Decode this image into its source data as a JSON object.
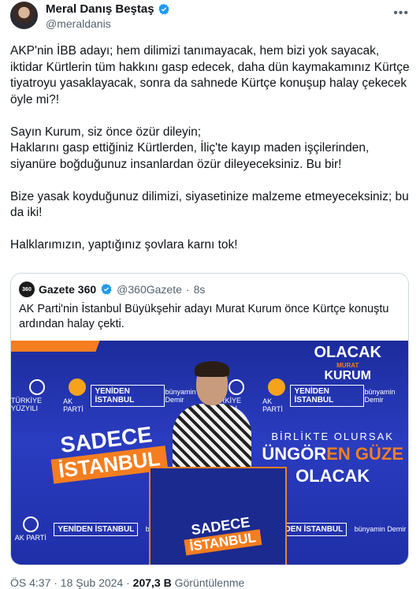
{
  "author": {
    "name": "Meral Danış Beştaş",
    "handle": "@meraldanis"
  },
  "tweet": {
    "paragraphs": [
      "AKP'nin İBB adayı; hem dilimizi tanımayacak, hem bizi yok sayacak, iktidar Kürtlerin tüm hakkını gasp edecek, daha dün kaymakamınız Kürtçe tiyatroyu yasaklayacak, sonra da sahnede Kürtçe konuşup halay çekecek öyle mi?!",
      "Sayın Kurum, siz önce özür dileyin;\nHaklarını gasp ettiğiniz Kürtlerden, İliç'te kayıp maden işçilerinden, siyanüre boğduğunuz insanlardan özür dileyeceksiniz. Bu bir!",
      "Bize yasak koyduğunuz dilimizi, siyasetinize malzeme etmeyeceksiniz; bu da iki!",
      "Halklarımızın, yaptığınız şovlara karnı tok!"
    ]
  },
  "quote": {
    "logo_text": "360",
    "name": "Gazete 360",
    "handle": "@360Gazete",
    "sep": "·",
    "time": "8s",
    "text": "AK Parti'nin İstanbul Büyükşehir adayı Murat Kurum önce Kürtçe konuştu ardından halay çekti.",
    "media": {
      "olacak": "OLACAK",
      "murat": "MURAT",
      "kurum": "KURUM",
      "sadece": "SADECE",
      "istanbul": "İSTANBUL",
      "birlikte": "BİRLİKTE OLURSAK",
      "gungoren_a": "ÜNGÖR",
      "gungoren_b": "EN GÜZE",
      "olacak2": "OLACAK",
      "turkiye": "TÜRKİYE YÜZYILI",
      "akparti": "AK PARTİ",
      "yeniden": "YENİDEN İSTANBUL",
      "bunyamin": "bünyamin Demir"
    }
  },
  "footer": {
    "time": "ÖS 4:37 · 18 Şub 2024 ·",
    "views": "207,3 B",
    "views_label": "Görüntülenme"
  },
  "colors": {
    "accent": "#1d9bf0",
    "orange": "#f47e20",
    "blue": "#2a3cc0"
  }
}
